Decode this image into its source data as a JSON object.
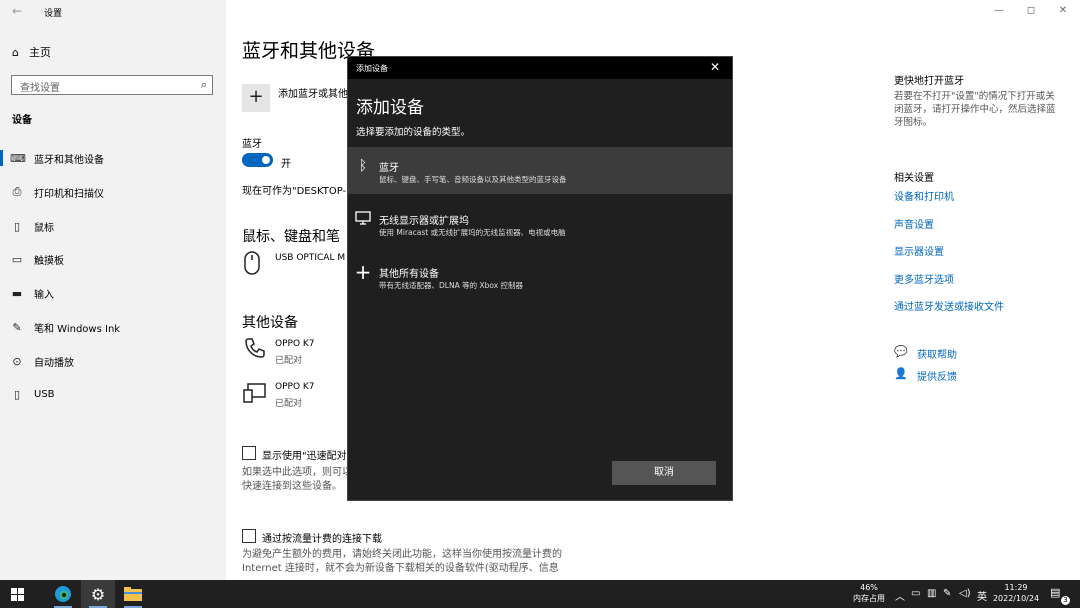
{
  "window": {
    "title": "设置",
    "back_glyph": "←",
    "min_glyph": "—",
    "max_glyph": "◻",
    "close_glyph": "✕"
  },
  "sidebar": {
    "home_label": "主页",
    "search_placeholder": "查找设置",
    "section_title": "设备",
    "items": [
      {
        "label": "蓝牙和其他设备",
        "icon": "bluetooth-devices-icon",
        "glyph": "⌨"
      },
      {
        "label": "打印机和扫描仪",
        "icon": "printer-icon",
        "glyph": "⎙"
      },
      {
        "label": "鼠标",
        "icon": "mouse-icon",
        "glyph": "▯"
      },
      {
        "label": "触摸板",
        "icon": "touchpad-icon",
        "glyph": "▭"
      },
      {
        "label": "输入",
        "icon": "keyboard-icon",
        "glyph": "▬"
      },
      {
        "label": "笔和 Windows Ink",
        "icon": "pen-icon",
        "glyph": "✎"
      },
      {
        "label": "自动播放",
        "icon": "autoplay-icon",
        "glyph": "⊙"
      },
      {
        "label": "USB",
        "icon": "usb-icon",
        "glyph": "▯"
      }
    ]
  },
  "main": {
    "title": "蓝牙和其他设备",
    "add_label": "添加蓝牙或其他设备",
    "bluetooth_label": "蓝牙",
    "bluetooth_state": "开",
    "discoverable_text": "现在可作为\"DESKTOP-IV",
    "mouse_section": "鼠标、键盘和笔",
    "mouse_device": "USB OPTICAL MOUSE",
    "other_section": "其他设备",
    "devices": [
      {
        "name": "OPPO K7",
        "status": "已配对",
        "icon": "phone-icon"
      },
      {
        "name": "OPPO K7",
        "status": "已配对",
        "icon": "device-icon"
      }
    ],
    "swift_pair_label": "显示使用\"迅速配对\"",
    "swift_pair_desc_1": "如果选中此选项，则可以",
    "swift_pair_desc_2": "快速连接到这些设备。",
    "metered_label": "通过按流量计费的连接下载",
    "metered_desc_1": "为避免产生额外的费用，请始终关闭此功能，这样当你使用按流量计费的",
    "metered_desc_2": "Internet 连接时，就不会为新设备下载相关的设备软件(驱动程序、信息"
  },
  "right": {
    "quick_title": "更快地打开蓝牙",
    "quick_text": "若要在不打开\"设置\"的情况下打开或关闭蓝牙，请打开操作中心，然后选择蓝牙图标。",
    "related_title": "相关设置",
    "links": [
      "设备和打印机",
      "声音设置",
      "显示器设置",
      "更多蓝牙选项",
      "通过蓝牙发送或接收文件"
    ],
    "help": "获取帮助",
    "feedback": "提供反馈"
  },
  "dialog": {
    "bar_title": "添加设备",
    "title": "添加设备",
    "subtitle": "选择要添加的设备的类型。",
    "options": [
      {
        "title": "蓝牙",
        "desc": "鼠标、键盘、手写笔、音频设备以及其他类型的蓝牙设备",
        "icon": "bluetooth-icon",
        "glyph": "ᛒ"
      },
      {
        "title": "无线显示器或扩展坞",
        "desc": "使用 Miracast 或无线扩展坞的无线监视器、电视或电脑",
        "icon": "monitor-icon",
        "glyph": "▭"
      },
      {
        "title": "其他所有设备",
        "desc": "带有无线适配器、DLNA 等的 Xbox 控制器",
        "icon": "plus-icon",
        "glyph": "+"
      }
    ],
    "cancel": "取消"
  },
  "taskbar": {
    "mem_percent": "46%",
    "mem_label": "内存占用",
    "ime": "英",
    "time": "11:29",
    "date": "2022/10/24",
    "notif_count": "3"
  }
}
